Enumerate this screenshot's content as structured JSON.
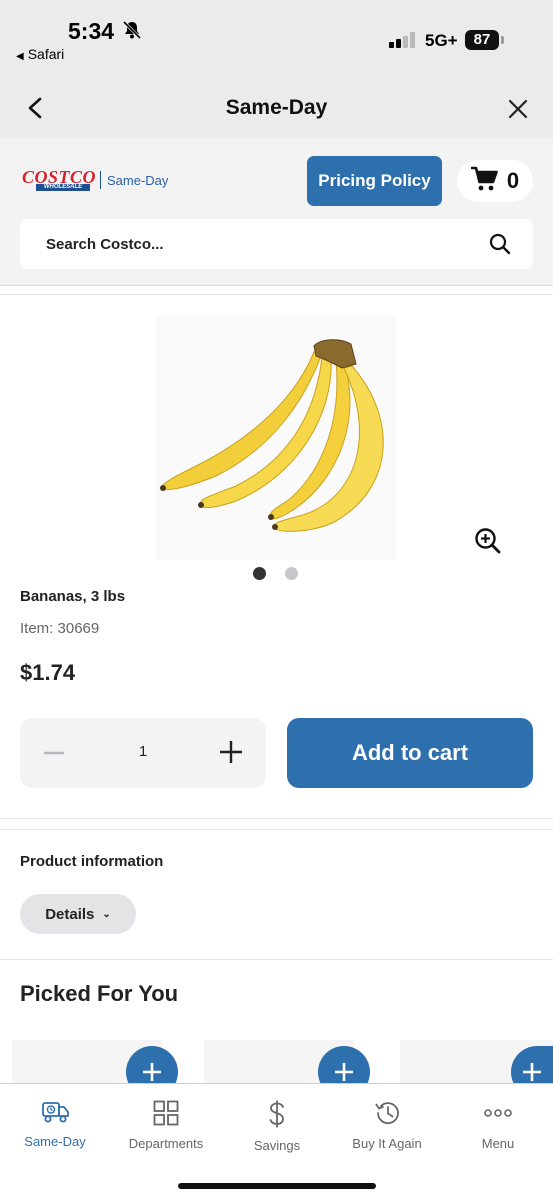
{
  "status_bar": {
    "time": "5:34",
    "network": "5G+",
    "battery": "87",
    "back_app": "Safari"
  },
  "nav": {
    "title": "Same-Day"
  },
  "header": {
    "logo_word": "COSTCO",
    "logo_sub": "WHOLESALE",
    "logo_label": "Same-Day",
    "pricing_button": "Pricing Policy",
    "cart_count": "0",
    "search_placeholder": "Search Costco..."
  },
  "product": {
    "name": "Bananas, 3 lbs",
    "item_number": "Item: 30669",
    "price": "$1.74",
    "quantity": "1",
    "add_to_cart": "Add to cart",
    "image_count": 2,
    "active_image": 1
  },
  "product_info": {
    "title": "Product information",
    "details_button": "Details"
  },
  "recommendations": {
    "title": "Picked For You"
  },
  "tabbar": {
    "items": [
      {
        "label": "Same-Day",
        "icon": "delivery-truck-icon",
        "active": true
      },
      {
        "label": "Departments",
        "icon": "grid-icon",
        "active": false
      },
      {
        "label": "Savings",
        "icon": "dollar-icon",
        "active": false
      },
      {
        "label": "Buy It Again",
        "icon": "history-icon",
        "active": false
      },
      {
        "label": "Menu",
        "icon": "more-dots-icon",
        "active": false
      }
    ]
  },
  "colors": {
    "brand_blue": "#2e6fad",
    "costco_red": "#d7202a",
    "costco_navy": "#1d4f91"
  }
}
